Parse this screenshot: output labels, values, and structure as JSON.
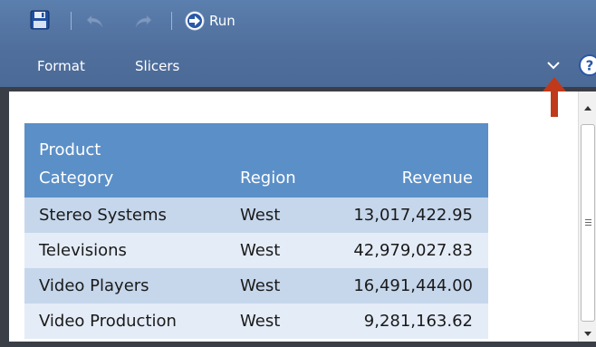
{
  "toolbar": {
    "run_label": "Run",
    "icons": [
      "save-icon",
      "undo-icon",
      "redo-icon",
      "run-icon"
    ]
  },
  "tabs": [
    {
      "label": "Format"
    },
    {
      "label": "Slicers"
    }
  ],
  "ribbon_controls": {
    "icons": [
      "chevron-down-icon",
      "help-icon"
    ]
  },
  "colors": {
    "ribbon": "#506f9c",
    "header": "#5b8fc8",
    "row_odd": "#c6d7ec",
    "row_even": "#e4ecf7",
    "annotation": "#c0391b"
  },
  "report": {
    "columns": [
      {
        "line1": "Product",
        "line2": "Category"
      },
      {
        "line1": "",
        "line2": "Region"
      },
      {
        "line1": "",
        "line2": "Revenue"
      }
    ],
    "rows": [
      {
        "category": "Stereo Systems",
        "region": "West",
        "revenue": "13,017,422.95"
      },
      {
        "category": "Televisions",
        "region": "West",
        "revenue": "42,979,027.83"
      },
      {
        "category": "Video Players",
        "region": "West",
        "revenue": "16,491,444.00"
      },
      {
        "category": "Video Production",
        "region": "West",
        "revenue": "9,281,163.62"
      }
    ]
  }
}
